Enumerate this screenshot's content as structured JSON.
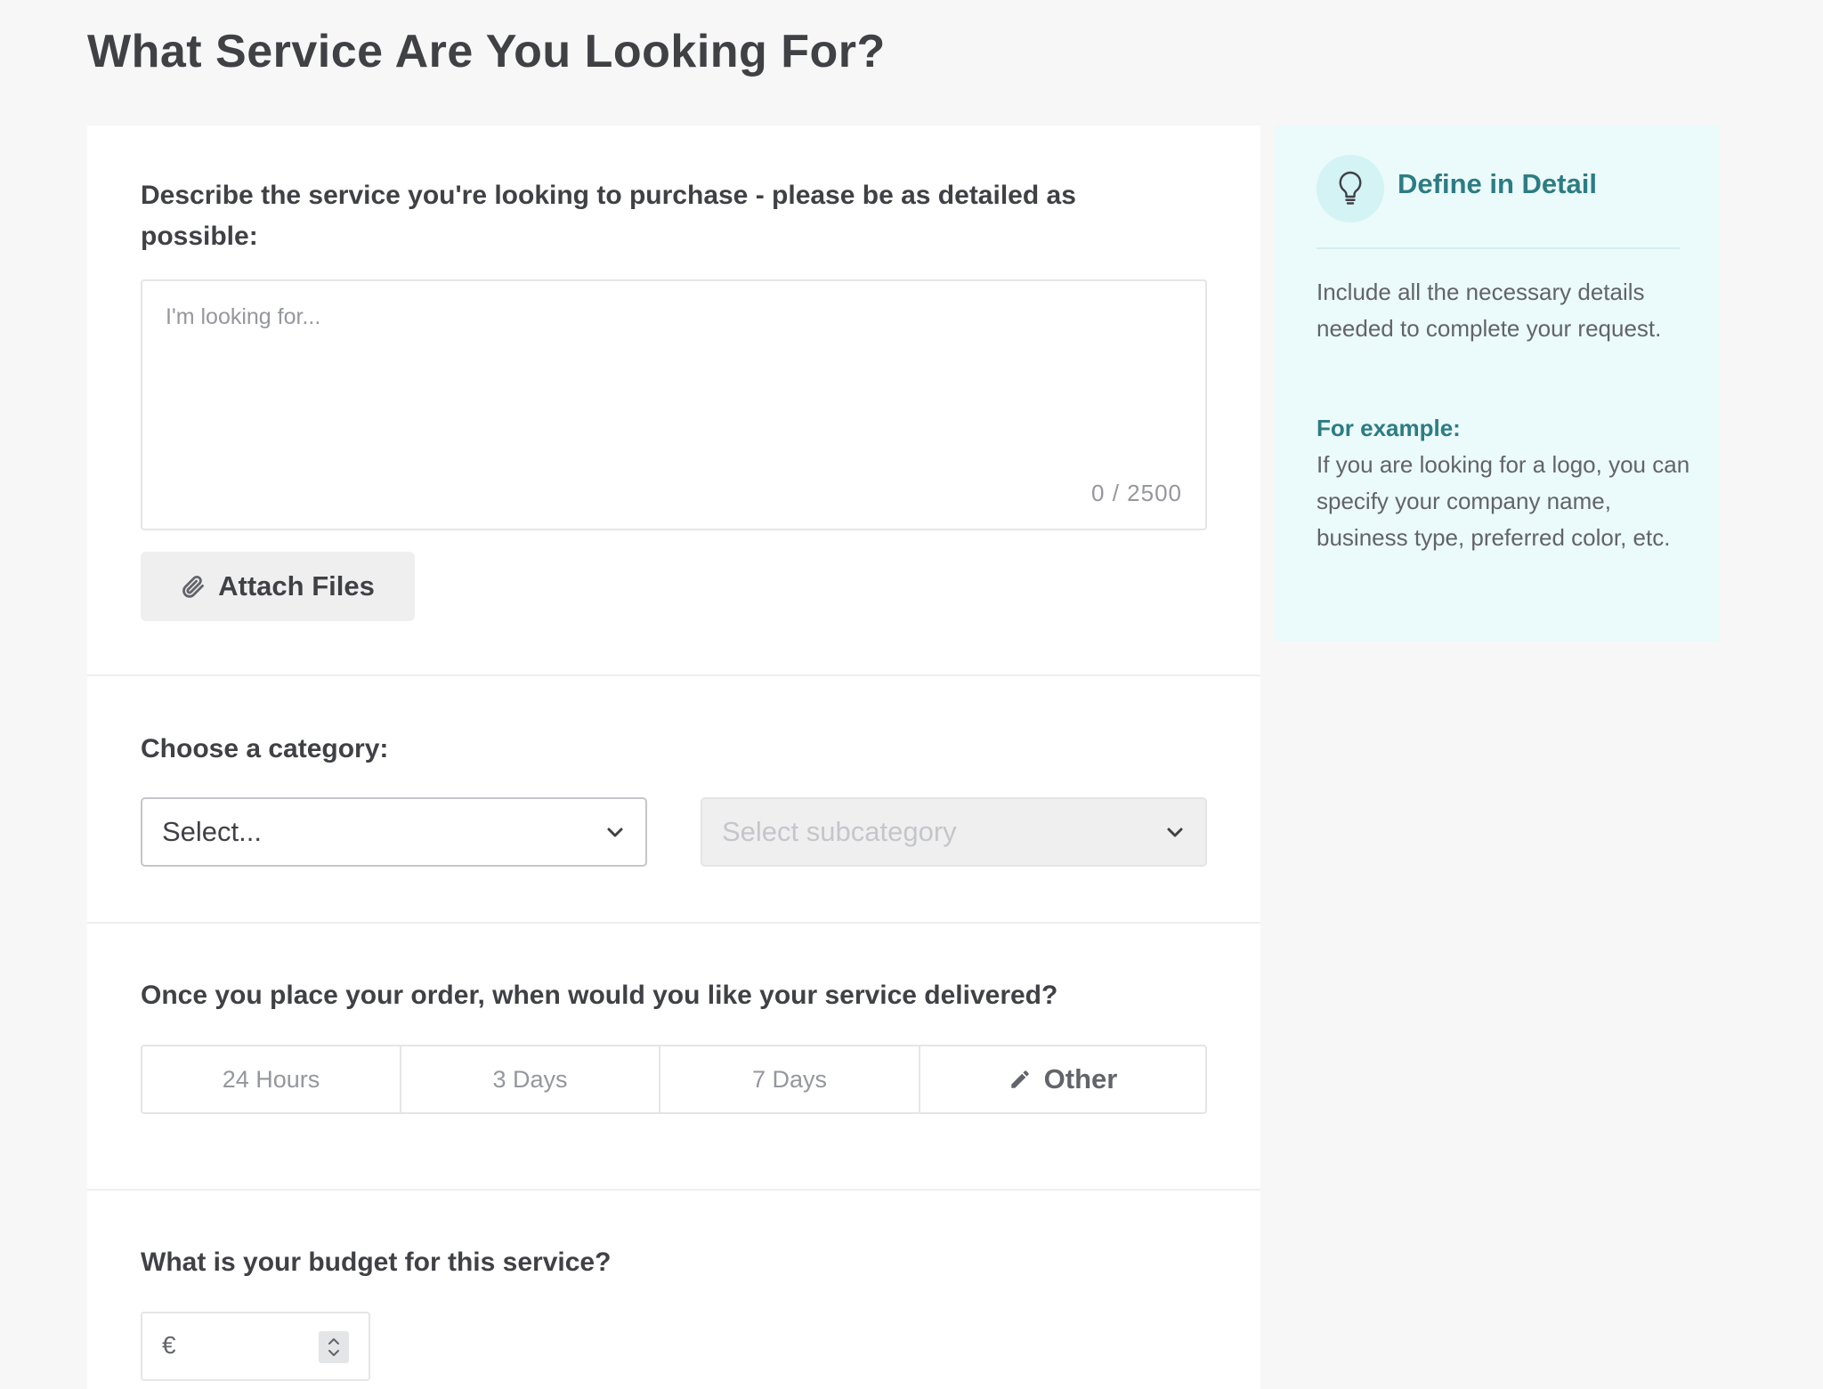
{
  "page": {
    "title": "What Service Are You Looking For?"
  },
  "description": {
    "label": "Describe the service you're looking to purchase - please be as detailed as possible:",
    "placeholder": "I'm looking for...",
    "counter": "0 / 2500",
    "attach_label": "Attach Files"
  },
  "category": {
    "label": "Choose a category:",
    "category_select": "Select...",
    "subcategory_select": "Select subcategory"
  },
  "delivery": {
    "label": "Once you place your order, when would you like your service delivered?",
    "options": [
      "24 Hours",
      "3 Days",
      "7 Days",
      "Other"
    ]
  },
  "budget": {
    "label": "What is your budget for this service?",
    "currency": "€"
  },
  "tip": {
    "title": "Define in Detail",
    "body": "Include all the necessary details needed to complete your request.",
    "example_label": "For example:",
    "example_body": "If you are looking for a logo, you can specify your company name, business type, preferred color, etc."
  },
  "colors": {
    "accent": "#2c7c83",
    "tip_background": "#ebfafb",
    "text": "#404145",
    "muted": "#95979d"
  },
  "icons": {
    "attach": "paperclip-icon",
    "select": "chevron-down-icon",
    "other": "pencil-icon",
    "tip": "lightbulb-icon",
    "stepper": "up-down-arrows-icon"
  }
}
